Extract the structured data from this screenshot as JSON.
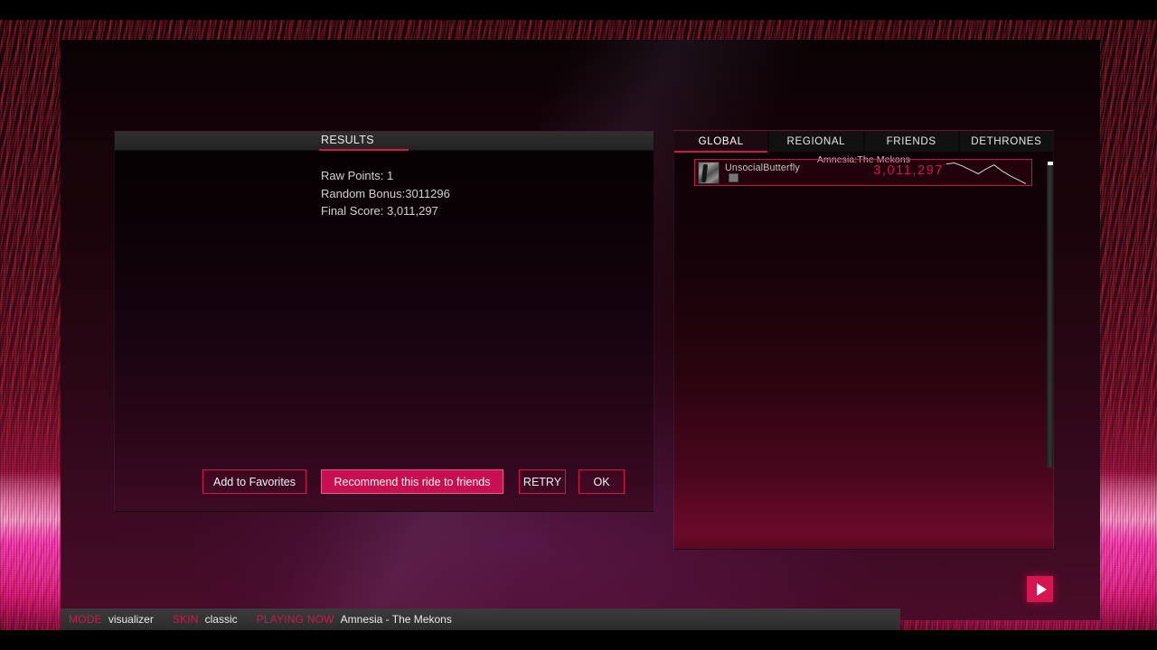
{
  "results": {
    "title": "RESULTS",
    "lines": [
      "Raw Points: 1",
      "Random Bonus:3011296",
      "Final Score: 3,011,297"
    ],
    "buttons": {
      "add_favorites": "Add to Favorites",
      "recommend": "Recommend this ride to friends",
      "retry": "RETRY",
      "ok": "OK"
    },
    "accent_color": "#d4154f"
  },
  "leaderboard": {
    "tabs": [
      {
        "label": "GLOBAL",
        "active": true
      },
      {
        "label": "REGIONAL",
        "active": false
      },
      {
        "label": "FRIENDS",
        "active": false
      },
      {
        "label": "DETHRONES",
        "active": false
      }
    ],
    "song_title": "Amnesia:The Mekons",
    "entries": [
      {
        "name": "UnsocialButterfly",
        "score": "3,011,297",
        "avatar": "player-avatar-thumbnail",
        "badge": "rank-badge-icon"
      }
    ],
    "score_color": "#d21450",
    "sparkline": [
      4,
      3,
      6,
      10,
      14,
      9,
      5,
      11,
      16,
      20,
      24
    ]
  },
  "statusbar": {
    "items": [
      {
        "key": "MODE",
        "value": "visualizer"
      },
      {
        "key": "SKIN",
        "value": "classic"
      },
      {
        "key": "PLAYING NOW",
        "value": "Amnesia - The Mekons"
      }
    ]
  },
  "transport": {
    "play_label": "play-icon"
  }
}
